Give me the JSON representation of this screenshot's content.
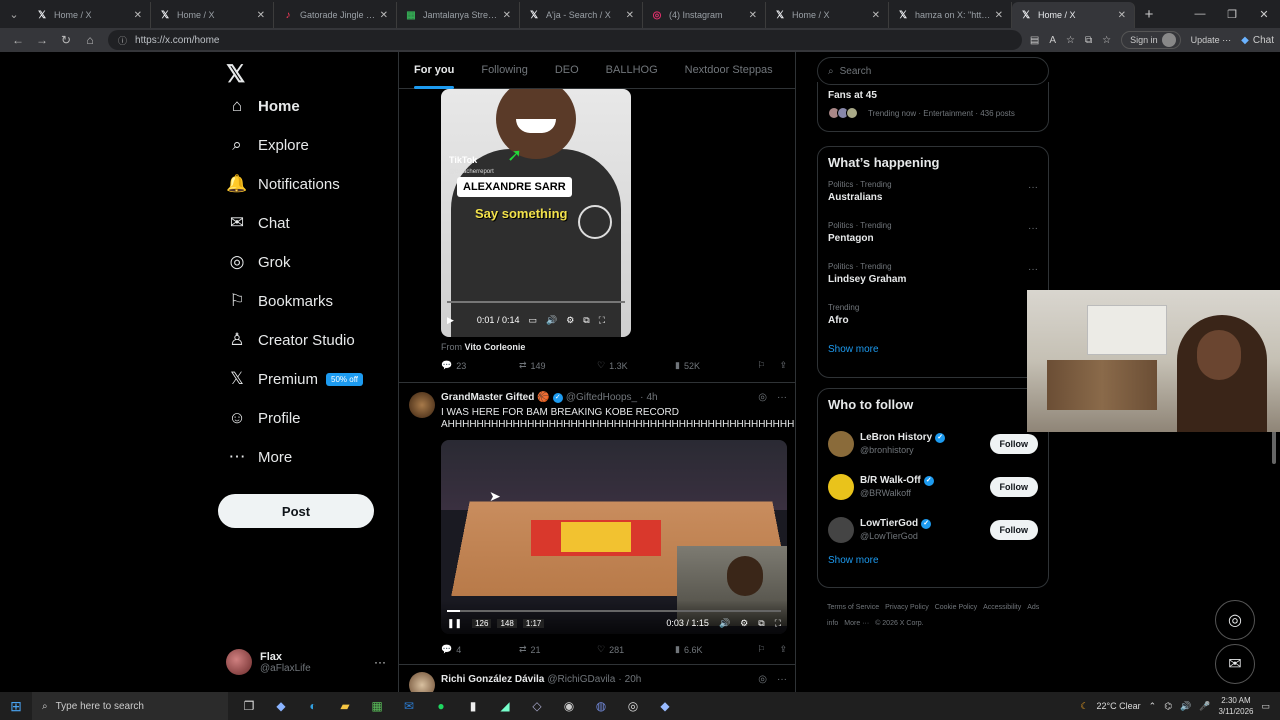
{
  "browser": {
    "tabs": [
      {
        "label": "Home / X",
        "icon": "x-icon",
        "active": false
      },
      {
        "label": "Home / X",
        "icon": "x-icon",
        "active": false
      },
      {
        "label": "Gatorade Jingle Remix",
        "icon": "tiktok-icon",
        "active": false
      },
      {
        "label": "Jamtalanya Stream - W",
        "icon": "sheet-icon",
        "active": false
      },
      {
        "label": "A'ja - Search / X",
        "icon": "x-icon",
        "active": false
      },
      {
        "label": "(4) Instagram",
        "icon": "instagram-icon",
        "active": false
      },
      {
        "label": "Home / X",
        "icon": "x-icon",
        "active": false
      },
      {
        "label": "hamza on X: \"https://t.c",
        "icon": "x-icon",
        "active": false
      },
      {
        "label": "Home / X",
        "icon": "x-icon",
        "active": true
      }
    ],
    "url": "https://x.com/home",
    "signin_label": "Sign in",
    "update_label": "Update",
    "chat_label": "Chat"
  },
  "nav": {
    "items": [
      {
        "label": "Home",
        "icon": "home-icon",
        "glyph": "⌂"
      },
      {
        "label": "Explore",
        "icon": "search-icon",
        "glyph": "⌕"
      },
      {
        "label": "Notifications",
        "icon": "bell-icon",
        "glyph": "🔔"
      },
      {
        "label": "Chat",
        "icon": "mail-icon",
        "glyph": "✉"
      },
      {
        "label": "Grok",
        "icon": "grok-icon",
        "glyph": "◎"
      },
      {
        "label": "Bookmarks",
        "icon": "bookmark-icon",
        "glyph": "⚐"
      },
      {
        "label": "Creator Studio",
        "icon": "creator-icon",
        "glyph": "♙"
      },
      {
        "label": "Premium",
        "icon": "x-logo-icon",
        "glyph": "𝕏"
      },
      {
        "label": "Profile",
        "icon": "person-icon",
        "glyph": "☺"
      },
      {
        "label": "More",
        "icon": "more-circle-icon",
        "glyph": "⋯"
      }
    ],
    "premium_badge": "50% off",
    "post_label": "Post",
    "profile": {
      "name": "Flax",
      "handle": "@aFlaxLife"
    }
  },
  "timeline": {
    "tabs": [
      "For you",
      "Following",
      "DEO",
      "BALLHOG",
      "Nextdoor Steppas"
    ],
    "tweet1": {
      "media_overlay": {
        "tiktok": "TikTok",
        "tiktok_handle": "@bleacherreport",
        "name_caption": "ALEXANDRE SARR",
        "caption": "Say something"
      },
      "video_time": "0:01 / 0:14",
      "from_prefix": "From",
      "from_name": "Vito Corleonie",
      "replies": "23",
      "reposts": "149",
      "likes": "1.3K",
      "views": "52K"
    },
    "tweet2": {
      "name": "GrandMaster Gifted",
      "handle": "@GiftedHoops_",
      "time": "4h",
      "text": "I WAS HERE FOR BAM BREAKING KOBE RECORD AHHHHHHHHHHHHHHHHHHHHHHHHHHHHHHHHHHHHHHHHHHHHHHHHH",
      "video_time": "0:03 / 1:15",
      "score_away": "126",
      "score_home": "148",
      "game_clock": "1:17",
      "video_progress": 0.04,
      "replies": "4",
      "reposts": "21",
      "likes": "281",
      "views": "6.6K"
    },
    "tweet3": {
      "name": "Richi González Dávila",
      "handle": "@RichiGDavila",
      "time": "20h"
    }
  },
  "right": {
    "search_placeholder": "Search",
    "fans": {
      "title": "Fans at 45",
      "meta": "Trending now · Entertainment · 436 posts"
    },
    "happening_title": "What’s happening",
    "trends": [
      {
        "meta": "Politics · Trending",
        "title": "Australians"
      },
      {
        "meta": "Politics · Trending",
        "title": "Pentagon"
      },
      {
        "meta": "Politics · Trending",
        "title": "Lindsey Graham"
      },
      {
        "meta": "Trending",
        "title": "Afro"
      }
    ],
    "show_more": "Show more",
    "wtf_title": "Who to follow",
    "follow_label": "Follow",
    "who_to_follow": [
      {
        "name": "LeBron History",
        "handle": "@bronhistory",
        "color": "#8a6b3a"
      },
      {
        "name": "B/R Walk-Off",
        "handle": "@BRWalkoff",
        "color": "#e9c31b"
      },
      {
        "name": "LowTierGod",
        "handle": "@LowTierGod",
        "color": "#444"
      }
    ],
    "footer": [
      "Terms of Service",
      "Privacy Policy",
      "Cookie Policy",
      "Accessibility",
      "Ads info",
      "More ···",
      "© 2026 X Corp."
    ]
  },
  "taskbar": {
    "search_placeholder": "Type here to search",
    "weather": "22°C  Clear",
    "time": "2:30 AM",
    "date": "3/11/2026"
  },
  "colors": {
    "accent": "#1d9bf0",
    "background": "#000000",
    "border": "#2f3336"
  }
}
